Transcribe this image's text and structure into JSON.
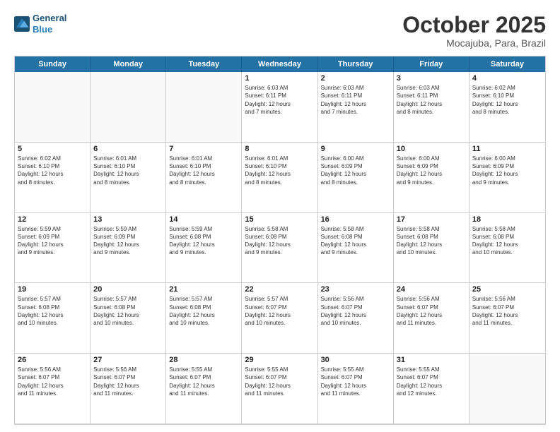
{
  "header": {
    "logo_line1": "General",
    "logo_line2": "Blue",
    "month": "October 2025",
    "location": "Mocajuba, Para, Brazil"
  },
  "day_headers": [
    "Sunday",
    "Monday",
    "Tuesday",
    "Wednesday",
    "Thursday",
    "Friday",
    "Saturday"
  ],
  "weeks": [
    [
      {
        "date": "",
        "info": ""
      },
      {
        "date": "",
        "info": ""
      },
      {
        "date": "",
        "info": ""
      },
      {
        "date": "1",
        "info": "Sunrise: 6:03 AM\nSunset: 6:11 PM\nDaylight: 12 hours\nand 7 minutes."
      },
      {
        "date": "2",
        "info": "Sunrise: 6:03 AM\nSunset: 6:11 PM\nDaylight: 12 hours\nand 7 minutes."
      },
      {
        "date": "3",
        "info": "Sunrise: 6:03 AM\nSunset: 6:11 PM\nDaylight: 12 hours\nand 8 minutes."
      },
      {
        "date": "4",
        "info": "Sunrise: 6:02 AM\nSunset: 6:10 PM\nDaylight: 12 hours\nand 8 minutes."
      }
    ],
    [
      {
        "date": "5",
        "info": "Sunrise: 6:02 AM\nSunset: 6:10 PM\nDaylight: 12 hours\nand 8 minutes."
      },
      {
        "date": "6",
        "info": "Sunrise: 6:01 AM\nSunset: 6:10 PM\nDaylight: 12 hours\nand 8 minutes."
      },
      {
        "date": "7",
        "info": "Sunrise: 6:01 AM\nSunset: 6:10 PM\nDaylight: 12 hours\nand 8 minutes."
      },
      {
        "date": "8",
        "info": "Sunrise: 6:01 AM\nSunset: 6:10 PM\nDaylight: 12 hours\nand 8 minutes."
      },
      {
        "date": "9",
        "info": "Sunrise: 6:00 AM\nSunset: 6:09 PM\nDaylight: 12 hours\nand 8 minutes."
      },
      {
        "date": "10",
        "info": "Sunrise: 6:00 AM\nSunset: 6:09 PM\nDaylight: 12 hours\nand 9 minutes."
      },
      {
        "date": "11",
        "info": "Sunrise: 6:00 AM\nSunset: 6:09 PM\nDaylight: 12 hours\nand 9 minutes."
      }
    ],
    [
      {
        "date": "12",
        "info": "Sunrise: 5:59 AM\nSunset: 6:09 PM\nDaylight: 12 hours\nand 9 minutes."
      },
      {
        "date": "13",
        "info": "Sunrise: 5:59 AM\nSunset: 6:09 PM\nDaylight: 12 hours\nand 9 minutes."
      },
      {
        "date": "14",
        "info": "Sunrise: 5:59 AM\nSunset: 6:08 PM\nDaylight: 12 hours\nand 9 minutes."
      },
      {
        "date": "15",
        "info": "Sunrise: 5:58 AM\nSunset: 6:08 PM\nDaylight: 12 hours\nand 9 minutes."
      },
      {
        "date": "16",
        "info": "Sunrise: 5:58 AM\nSunset: 6:08 PM\nDaylight: 12 hours\nand 9 minutes."
      },
      {
        "date": "17",
        "info": "Sunrise: 5:58 AM\nSunset: 6:08 PM\nDaylight: 12 hours\nand 10 minutes."
      },
      {
        "date": "18",
        "info": "Sunrise: 5:58 AM\nSunset: 6:08 PM\nDaylight: 12 hours\nand 10 minutes."
      }
    ],
    [
      {
        "date": "19",
        "info": "Sunrise: 5:57 AM\nSunset: 6:08 PM\nDaylight: 12 hours\nand 10 minutes."
      },
      {
        "date": "20",
        "info": "Sunrise: 5:57 AM\nSunset: 6:08 PM\nDaylight: 12 hours\nand 10 minutes."
      },
      {
        "date": "21",
        "info": "Sunrise: 5:57 AM\nSunset: 6:08 PM\nDaylight: 12 hours\nand 10 minutes."
      },
      {
        "date": "22",
        "info": "Sunrise: 5:57 AM\nSunset: 6:07 PM\nDaylight: 12 hours\nand 10 minutes."
      },
      {
        "date": "23",
        "info": "Sunrise: 5:56 AM\nSunset: 6:07 PM\nDaylight: 12 hours\nand 10 minutes."
      },
      {
        "date": "24",
        "info": "Sunrise: 5:56 AM\nSunset: 6:07 PM\nDaylight: 12 hours\nand 11 minutes."
      },
      {
        "date": "25",
        "info": "Sunrise: 5:56 AM\nSunset: 6:07 PM\nDaylight: 12 hours\nand 11 minutes."
      }
    ],
    [
      {
        "date": "26",
        "info": "Sunrise: 5:56 AM\nSunset: 6:07 PM\nDaylight: 12 hours\nand 11 minutes."
      },
      {
        "date": "27",
        "info": "Sunrise: 5:56 AM\nSunset: 6:07 PM\nDaylight: 12 hours\nand 11 minutes."
      },
      {
        "date": "28",
        "info": "Sunrise: 5:55 AM\nSunset: 6:07 PM\nDaylight: 12 hours\nand 11 minutes."
      },
      {
        "date": "29",
        "info": "Sunrise: 5:55 AM\nSunset: 6:07 PM\nDaylight: 12 hours\nand 11 minutes."
      },
      {
        "date": "30",
        "info": "Sunrise: 5:55 AM\nSunset: 6:07 PM\nDaylight: 12 hours\nand 11 minutes."
      },
      {
        "date": "31",
        "info": "Sunrise: 5:55 AM\nSunset: 6:07 PM\nDaylight: 12 hours\nand 12 minutes."
      },
      {
        "date": "",
        "info": ""
      }
    ]
  ]
}
